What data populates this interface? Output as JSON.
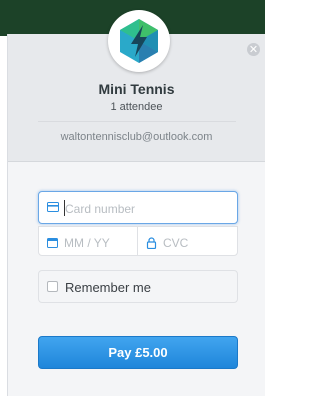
{
  "brand": {
    "accent": "#2b8ee0",
    "topbar_color": "#1c4228"
  },
  "header": {
    "logo_icon": "lightning-hexagon-logo",
    "close_icon": "close-icon",
    "title": "Mini Tennis",
    "subtitle": "1 attendee",
    "email": "waltontennisclub@outlook.com"
  },
  "form": {
    "card_number": {
      "placeholder": "Card number",
      "icon": "credit-card-icon"
    },
    "expiry": {
      "placeholder": "MM / YY",
      "icon": "calendar-icon"
    },
    "cvc": {
      "placeholder": "CVC",
      "icon": "lock-icon"
    },
    "remember_label": "Remember me",
    "remember_checked": false
  },
  "pay_button": {
    "label": "Pay £5.00"
  }
}
